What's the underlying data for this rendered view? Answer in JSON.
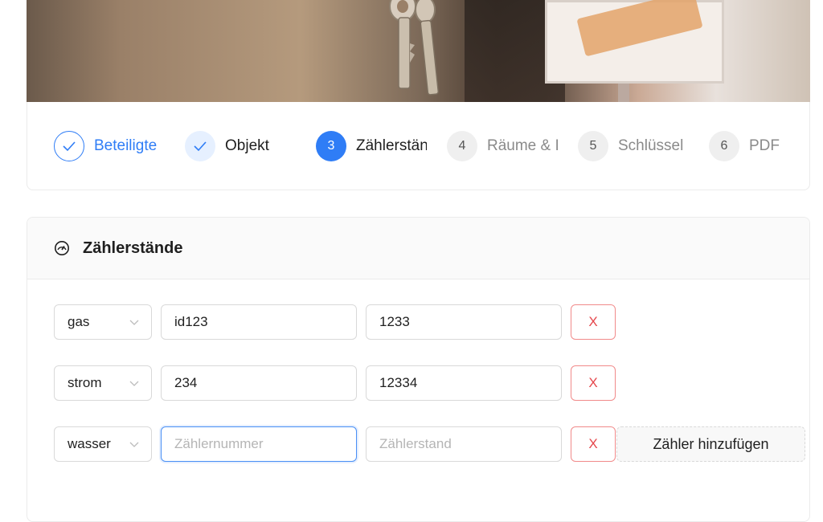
{
  "stepper": {
    "steps": [
      {
        "number": "",
        "label": "Beteiligte",
        "state": "done"
      },
      {
        "number": "",
        "label": "Objekt",
        "state": "done"
      },
      {
        "number": "3",
        "label": "Zählerstände",
        "state": "active"
      },
      {
        "number": "4",
        "label": "Räume & Inventar",
        "state": "pending"
      },
      {
        "number": "5",
        "label": "Schlüssel",
        "state": "pending"
      },
      {
        "number": "6",
        "label": "PDF",
        "state": "pending"
      }
    ]
  },
  "meters": {
    "title": "Zählerstände",
    "icon": "gauge-icon",
    "rows": [
      {
        "type": "gas",
        "number": "id123",
        "reading": "1233"
      },
      {
        "type": "strom",
        "number": "234",
        "reading": "12334"
      },
      {
        "type": "wasser",
        "number": "",
        "reading": ""
      }
    ],
    "number_placeholder": "Zählernummer",
    "reading_placeholder": "Zählerstand",
    "delete_label": "X",
    "add_label": "Zähler hinzufügen"
  },
  "colors": {
    "primary": "#2f7df6",
    "danger": "#e5484d",
    "border": "#d9d9d9"
  }
}
